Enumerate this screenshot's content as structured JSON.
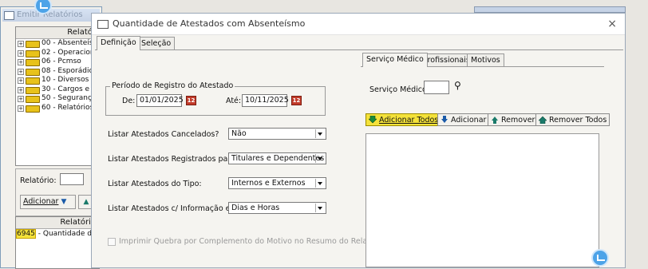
{
  "bg_window": {
    "title": "Emitir Relatórios",
    "tree_header": "Relatór",
    "tree_items": [
      "00 - Absenteís",
      "02 - Operacion",
      "06 - Pcmso",
      "08 - Esporádic",
      "10 - Diversos",
      "30 - Cargos e S",
      "50 - Segurança",
      "60 - Relatórios"
    ],
    "relatorio_label": "Relatório:",
    "adicionar_label": "Adicionar",
    "bottom_header": "Relatório",
    "report_code": "6945",
    "report_text": " - Quantidade de A"
  },
  "dialog": {
    "title": "Quantidade de Atestados com Absenteísmo",
    "close_label": "×",
    "tabs": [
      "Definição",
      "Seleção"
    ],
    "periodo": {
      "legend": "Período de Registro do Atestado",
      "de_label": "De:",
      "de_value": "01/01/2025",
      "ate_label": "Até:",
      "ate_value": "10/11/2025"
    },
    "fields": [
      {
        "label": "Listar Atestados Cancelados?",
        "value": "Não"
      },
      {
        "label": "Listar Atestados Registrados para:",
        "value": "Titulares e Dependentes"
      },
      {
        "label": "Listar Atestados do Tipo:",
        "value": "Internos e Externos"
      },
      {
        "label": "Listar Atestados c/ Informação em:",
        "value": "Dias e Horas"
      }
    ],
    "checkbox_label": "Imprimir Quebra por Complemento do Motivo no Resumo do Relatório",
    "right_tabs": [
      "Serviço Médico",
      "Profissionais",
      "Motivos"
    ],
    "servico_label": "Serviço Médico:",
    "buttons": {
      "add_all": "Adicionar Todos",
      "add": "Adicionar",
      "remove": "Remover",
      "remove_all": "Remover Todos"
    }
  },
  "colors": {
    "highlight_button": "#f4e23a",
    "calendar_icon": "#c23b2a",
    "circle_badge": "#4da3e8"
  }
}
